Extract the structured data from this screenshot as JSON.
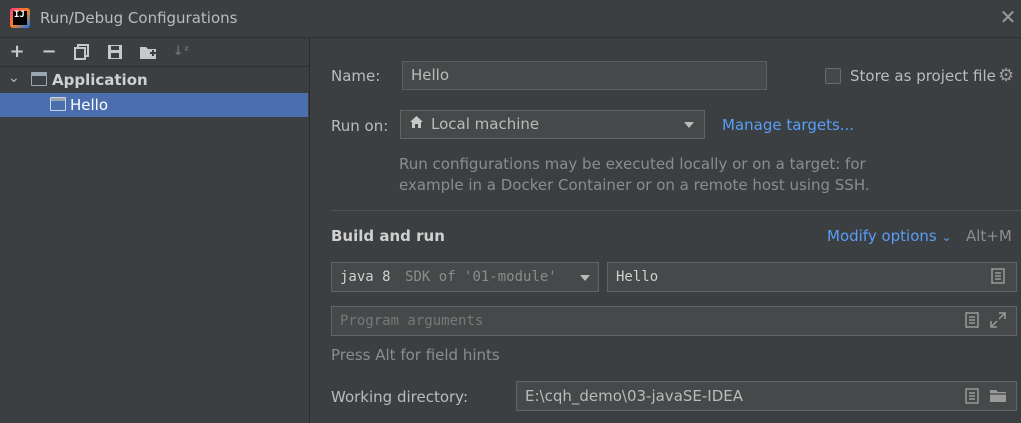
{
  "window": {
    "title": "Run/Debug Configurations",
    "app_icon_text": "IJ"
  },
  "toolbar": {
    "add": "+",
    "remove": "−"
  },
  "tree": {
    "group_label": "Application",
    "item_label": "Hello"
  },
  "form": {
    "name_label": "Name:",
    "name_value": "Hello",
    "store_label": "Store as project file",
    "store_checked": false,
    "run_on_label": "Run on:",
    "run_on_value": "Local machine",
    "manage_targets": "Manage targets...",
    "run_hint_line1": "Run configurations may be executed locally or on a target: for",
    "run_hint_line2": "example in a Docker Container or on a remote host using SSH.",
    "section_title": "Build and run",
    "modify_options": "Modify options",
    "modify_shortcut": "Alt+M",
    "sdk_main": "java 8",
    "sdk_detail": "SDK of '01-module'",
    "main_class": "Hello",
    "program_args_placeholder": "Program arguments",
    "field_hint": "Press Alt for field hints",
    "workdir_label": "Working directory:",
    "workdir_value": "E:\\cqh_demo\\03-javaSE-IDEA"
  },
  "colors": {
    "background": "#3c3f41",
    "selection": "#4b6eaf",
    "link": "#589df6",
    "field": "#45494a"
  }
}
